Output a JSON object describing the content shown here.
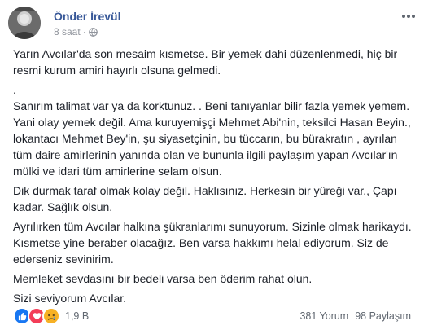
{
  "post": {
    "author": "Önder İrevül",
    "timestamp": "8 saat",
    "separator": "·",
    "privacy_icon": "globe-icon",
    "more_icon": "more-options-icon",
    "paragraphs": [
      "Yarın Avcılar'da son mesaim kısmetse. Bir yemek dahi düzenlenmedi, hiç bir resmi kurum amiri hayırlı olsuna gelmedi.",
      ".",
      "Sanırım talimat var ya da korktunuz. . Beni tanıyanlar bilir fazla yemek yemem. Yani olay yemek değil. Ama kuruyemişçi Mehmet Abi'nin, teksilci Hasan Beyin., lokantacı Mehmet Bey'in, şu siyasetçinin, bu tüccarın, bu bürakratın , ayrılan tüm daire amirlerinin yanında olan ve bununla ilgili paylaşım yapan Avcılar'ın mülki ve idari tüm amirlerine selam olsun.",
      "Dik durmak taraf olmak kolay değil. Haklısınız. Herkesin bir yüreği var., Çapı kadar. Sağlık olsun.",
      "Ayrılırken tüm Avcılar halkına şükranlarımı sunuyorum. Sizinle olmak harikaydı. Kısmetse yine beraber olacağız. Ben varsa hakkımı helal ediyorum. Siz de ederseniz sevinirim.",
      "Memleket sevdasını bir bedeli varsa ben öderim rahat olun.",
      "Sizi seviyorum Avcılar."
    ]
  },
  "footer": {
    "reactions": [
      "like-icon",
      "love-icon",
      "sad-icon"
    ],
    "reaction_count": "1,9 B",
    "comments": "381 Yorum",
    "shares": "98 Paylaşım"
  },
  "colors": {
    "author_link": "#385898",
    "meta_gray": "#90949c",
    "like_blue": "#1877f2",
    "love_red": "#f33e58",
    "sad_yellow": "#f7b125"
  }
}
